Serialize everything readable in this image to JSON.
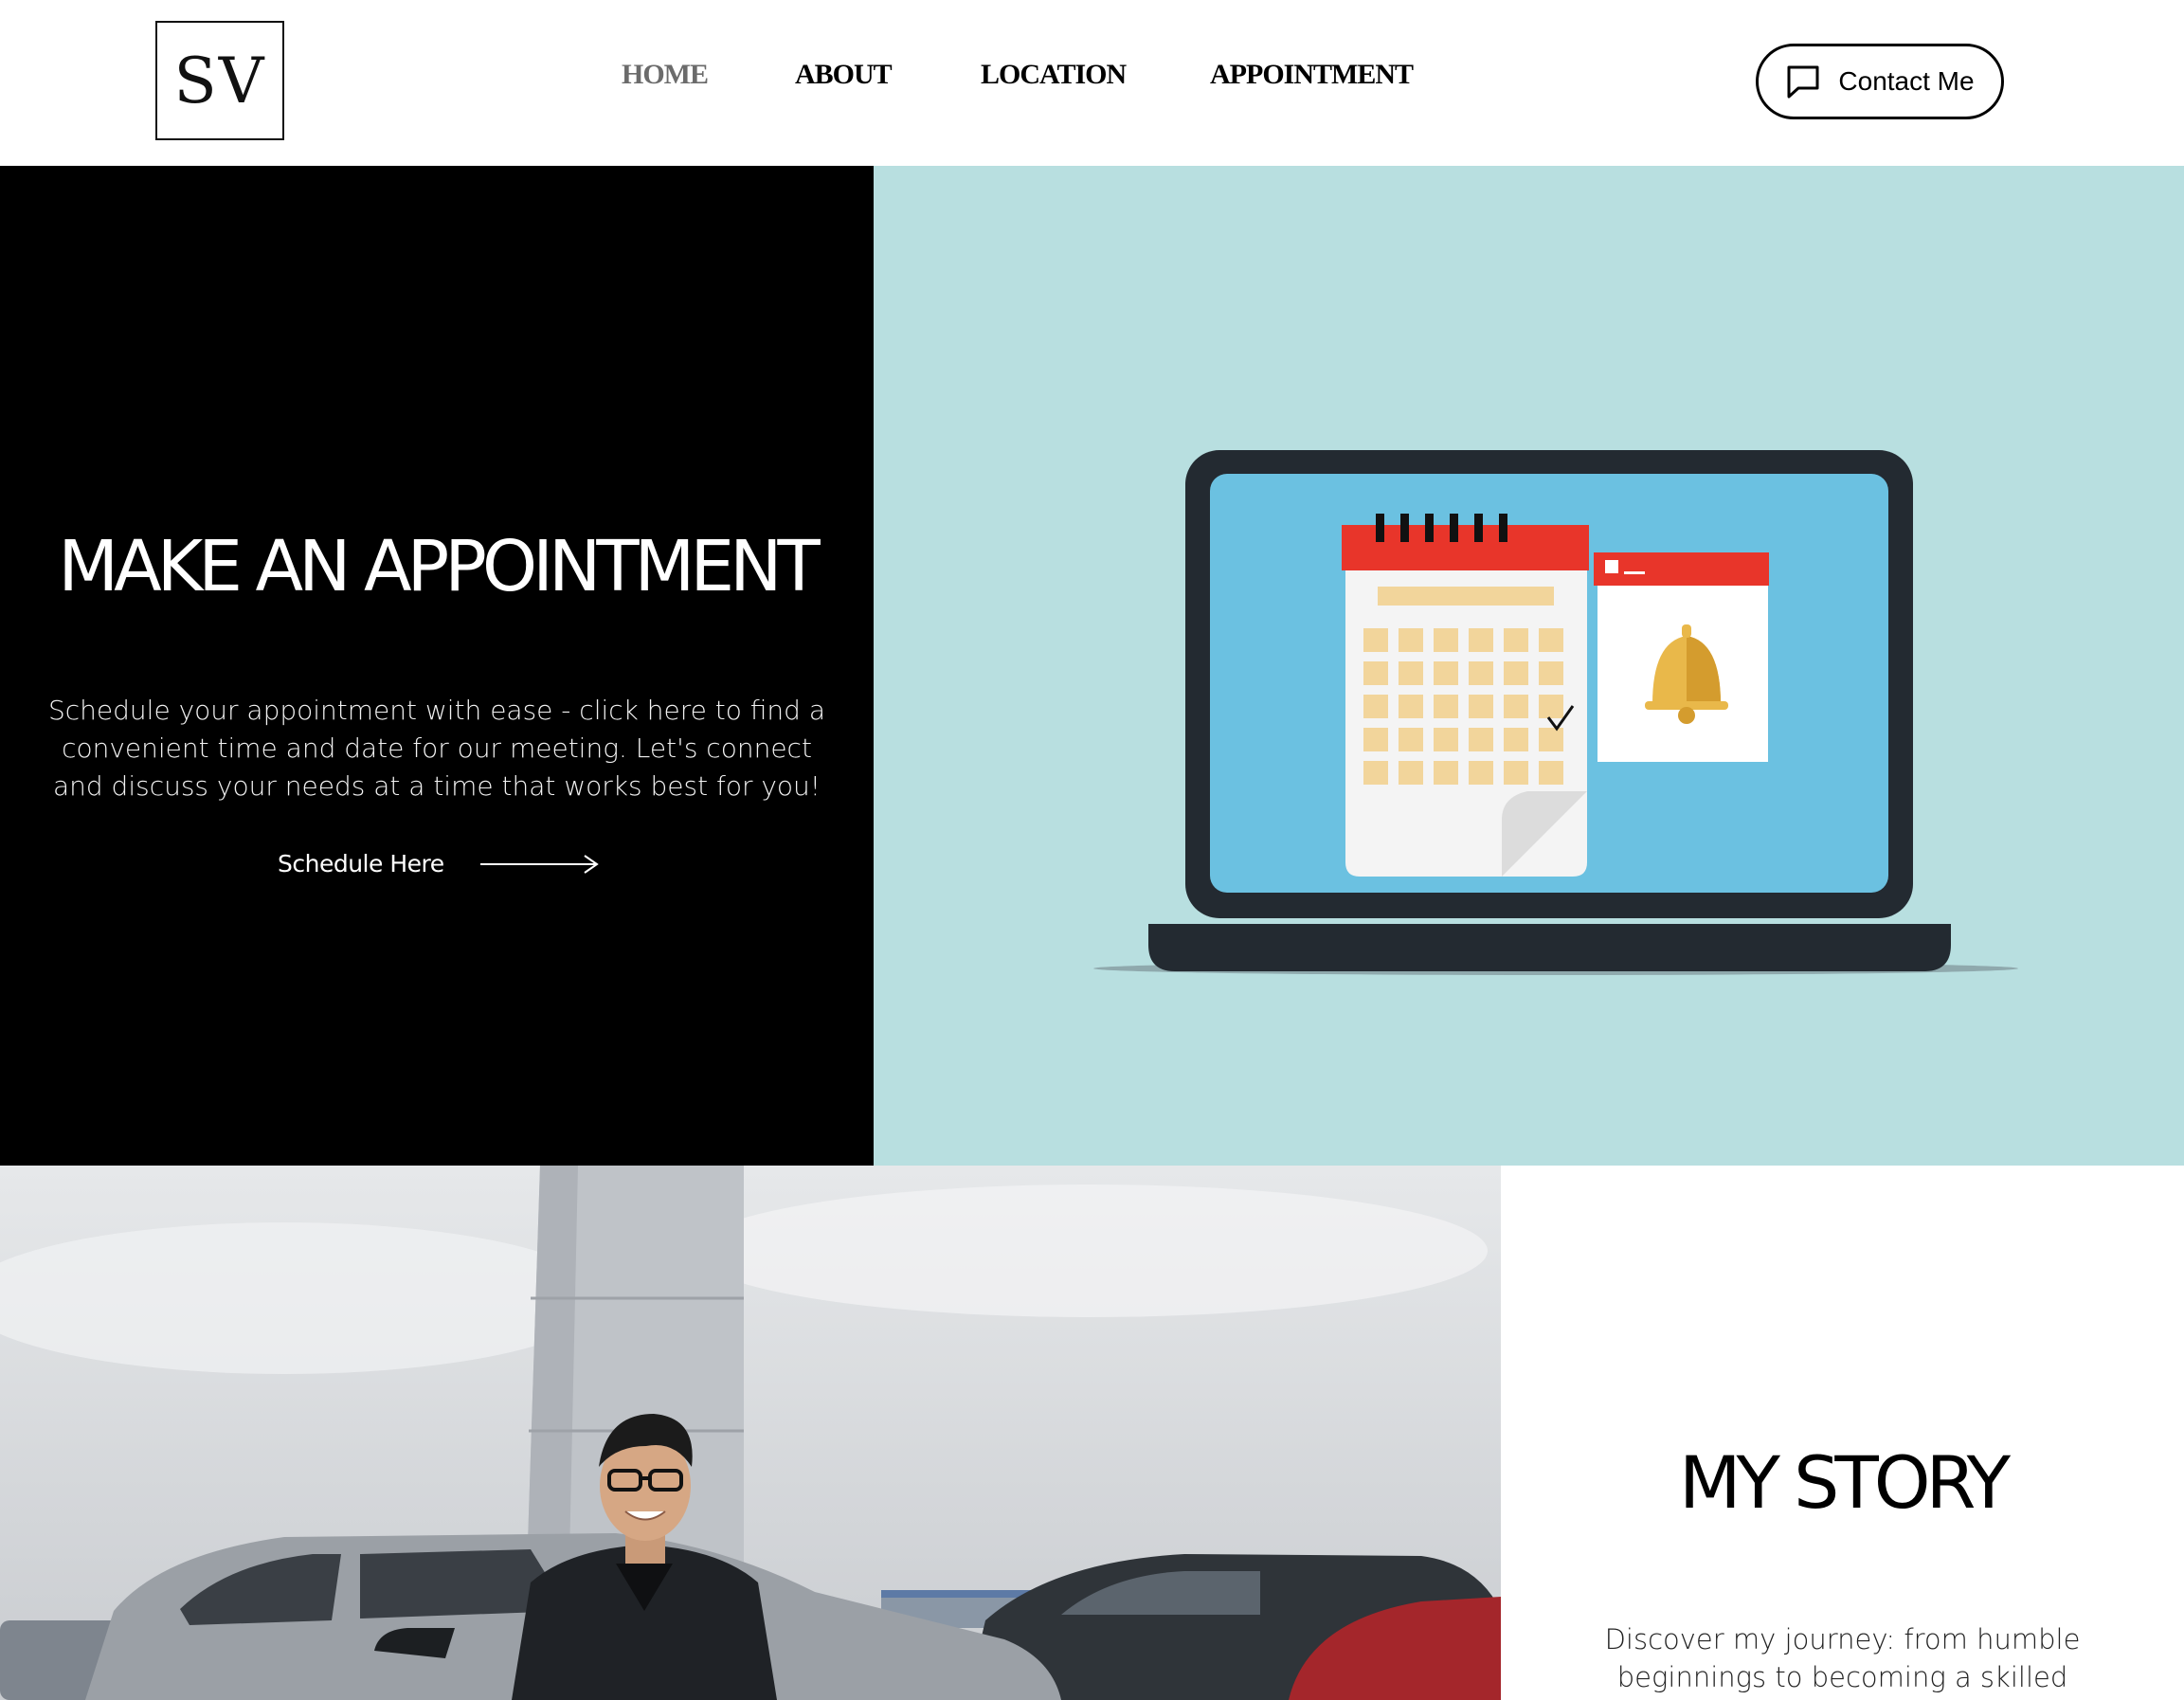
{
  "header": {
    "logo_text": "SV",
    "nav": [
      {
        "label": "HOME",
        "active": true
      },
      {
        "label": "ABOUT",
        "active": false
      },
      {
        "label": "LOCATION",
        "active": false
      },
      {
        "label": "APPOINTMENT",
        "active": false
      }
    ],
    "contact_label": "Contact Me",
    "contact_icon": "chat-bubble-icon"
  },
  "hero": {
    "title": "MAKE AN APPOINTMENT",
    "description": "Schedule your appointment with ease - click here to find a convenient time and date for our meeting. Let's connect and discuss your needs at a time that works best for you!",
    "link_label": "Schedule Here",
    "link_icon": "long-arrow-right-icon",
    "illustration": "laptop-calendar-reminder-illustration"
  },
  "story": {
    "title": "MY STORY",
    "description": "Discover my journey: from humble beginnings to becoming a skilled"
  },
  "colors": {
    "hero_left_bg": "#000000",
    "hero_right_bg": "#b8dfe0",
    "nav_active": "#6b6b6b",
    "laptop_frame": "#232a31",
    "laptop_screen": "#6bc1e1",
    "calendar_header": "#e8352a",
    "calendar_cell": "#f2d59b",
    "bell": "#e9b84a"
  }
}
